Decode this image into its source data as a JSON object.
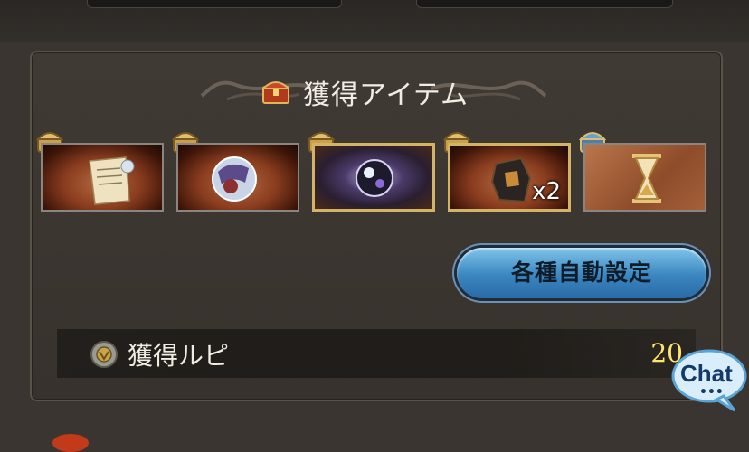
{
  "header": {
    "title": "獲得アイテム",
    "title_icon": "treasure-chest-icon"
  },
  "items": [
    {
      "name": "scroll",
      "icon": "scroll-icon",
      "frame": "silver",
      "badge": "gold-chest-badge",
      "count": ""
    },
    {
      "name": "character-orb",
      "icon": "character-orb-icon",
      "frame": "silver",
      "badge": "gold-chest-badge",
      "count": ""
    },
    {
      "name": "crystal-orb",
      "icon": "crystal-orb-icon",
      "frame": "gold",
      "badge": "gold-chest-badge",
      "count": ""
    },
    {
      "name": "rock-shard",
      "icon": "rock-shard-icon",
      "frame": "gold",
      "badge": "gold-chest-badge",
      "count": "x2"
    },
    {
      "name": "hourglass",
      "icon": "hourglass-icon",
      "frame": "silver",
      "badge": "blue-chest-badge",
      "count": ""
    }
  ],
  "auto_settings": {
    "label": "各種自動設定"
  },
  "rupee": {
    "label": "獲得ルピ",
    "value": "20",
    "value_color": "#ffe56a"
  },
  "chat": {
    "label": "Chat",
    "dots": "•••"
  }
}
